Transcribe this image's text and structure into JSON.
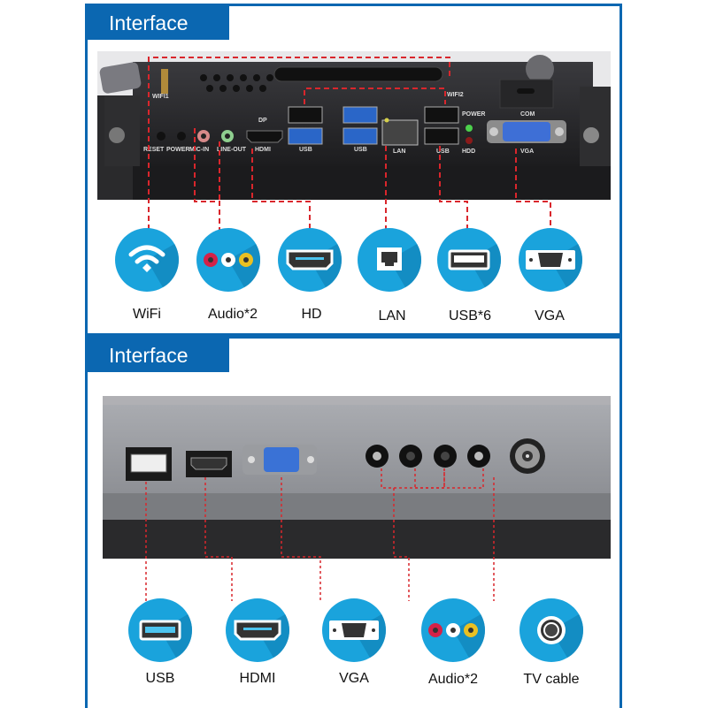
{
  "sections": [
    {
      "title": "Interface",
      "photo_labels": {
        "wifi1": "WIFI1",
        "wifi2": "WIFI2",
        "reset": "RESET",
        "power": "POWER",
        "mic_in": "MIC-IN",
        "line_out": "LINE-OUT",
        "dp": "DP",
        "hdmi": "HDMI",
        "usb_a": "USB",
        "usb_b": "USB",
        "lan": "LAN",
        "usb_c": "USB",
        "power_led": "POWER",
        "hdd_led": "HDD",
        "com": "COM",
        "vga": "VGA"
      },
      "items": [
        {
          "label": "WiFi",
          "icon": "wifi-icon"
        },
        {
          "label": "Audio*2",
          "icon": "audio-jacks-icon"
        },
        {
          "label": "HD",
          "icon": "hdmi-port-icon"
        },
        {
          "label": "LAN",
          "icon": "ethernet-port-icon"
        },
        {
          "label": "USB*6",
          "icon": "usb-port-icon"
        },
        {
          "label": "VGA",
          "icon": "vga-port-icon"
        }
      ]
    },
    {
      "title": "Interface",
      "items": [
        {
          "label": "USB",
          "icon": "usb-port-icon"
        },
        {
          "label": "HDMI",
          "icon": "hdmi-port-icon"
        },
        {
          "label": "VGA",
          "icon": "vga-port-icon"
        },
        {
          "label": "Audio*2",
          "icon": "audio-jacks-icon"
        },
        {
          "label": "TV cable",
          "icon": "coax-port-icon"
        }
      ]
    }
  ],
  "colors": {
    "brand_blue": "#0b67b1",
    "icon_blue": "#1aa3dc",
    "leader_line_red": "#d9262c"
  }
}
